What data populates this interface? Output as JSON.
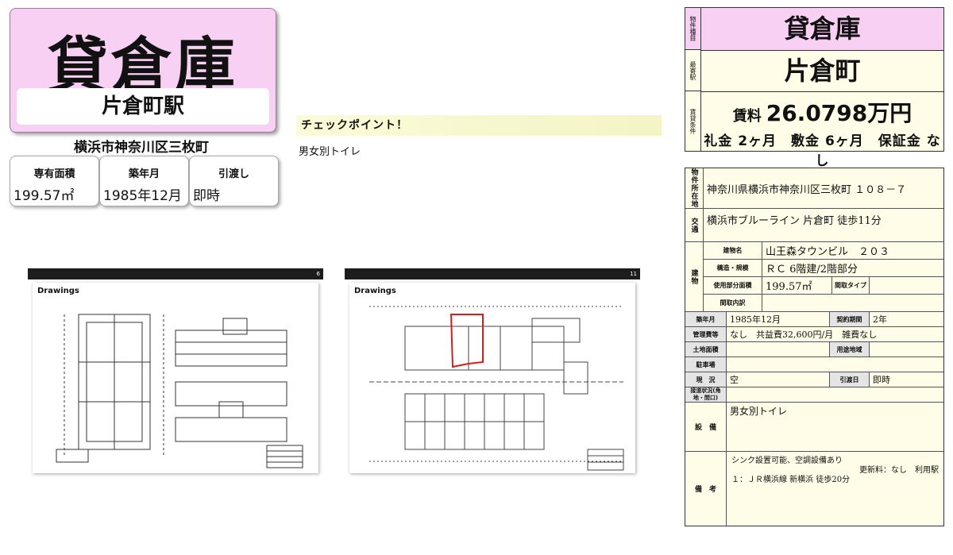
{
  "header": {
    "property_type": "貸倉庫",
    "station": "片倉町駅",
    "address": "横浜市神奈川区三枚町"
  },
  "summary_cards": [
    {
      "label": "専有面積",
      "value": "199.57㎡"
    },
    {
      "label": "築年月",
      "value": "1985年12月"
    },
    {
      "label": "引渡し",
      "value": "即時"
    }
  ],
  "checkpoint": {
    "title": "チェックポイント！",
    "body": "男女別トイレ"
  },
  "drawings": [
    {
      "title": "Drawings",
      "page": "6"
    },
    {
      "title": "Drawings",
      "page": "11"
    }
  ],
  "info_top": {
    "label_type": "物件種目",
    "type": "貸倉庫",
    "label_station": "最寄駅",
    "station": "片倉町",
    "label_terms": "賃貸条件",
    "rent_label": "賃料",
    "rent_value": "26.0798万円",
    "fees": "礼金 2ヶ月　敷金 6ヶ月　保証金 なし"
  },
  "detail": {
    "location_label": "物件所在地",
    "location": "神奈川県横浜市神奈川区三枚町 １０８－７",
    "transport_label": "交通",
    "transport": "横浜市ブルーライン 片倉町 徒歩11分",
    "building_label": "建物",
    "building_name_label": "建物名",
    "building_name": "山王森タウンビル　２０３",
    "structure_label": "構造・規模",
    "structure": "ＲＣ 6階建/2階部分",
    "area_label": "使用部分面積",
    "area": "199.57㎡",
    "layout_type_label": "間取タイプ",
    "layout_type": "",
    "layout_detail_label": "間取内訳",
    "layout_detail": "",
    "built_label": "築年月",
    "built": "1985年12月",
    "contract_label": "契約期間",
    "contract": "2年",
    "mgmt_label": "管理費等",
    "mgmt": "なし　共益費32,600円/月　雑費なし",
    "land_label": "土地面積",
    "land": "",
    "zoning_label": "用途地域",
    "zoning": "",
    "parking_label": "駐車場",
    "parking": "",
    "status_label": "現　況",
    "status": "空",
    "handover_label": "引渡日",
    "handover": "即時",
    "road_label": "接道状況(角地・間口)",
    "road": "",
    "facilities_label": "設　備",
    "facilities": "男女別トイレ",
    "remarks_label": "備　考",
    "remarks_1": "シンク設置可能、空調設備あり",
    "remarks_2": "更新料：なし　利用駅",
    "remarks_3": "１：ＪＲ横浜線 新横浜 徒歩20分"
  }
}
